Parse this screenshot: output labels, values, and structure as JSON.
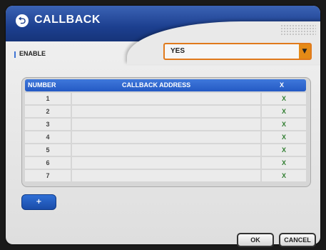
{
  "window": {
    "title": "CALLBACK",
    "title_icon": "circle-arrow-icon"
  },
  "enable": {
    "label": "ENABLE",
    "value": "YES",
    "arrow_icon": "dropdown-arrow-icon"
  },
  "table": {
    "headers": [
      "NUMBER",
      "CALLBACK ADDRESS",
      "X"
    ],
    "rows": [
      {
        "number": "1",
        "address": "",
        "delete": "X"
      },
      {
        "number": "2",
        "address": "",
        "delete": "X"
      },
      {
        "number": "3",
        "address": "",
        "delete": "X"
      },
      {
        "number": "4",
        "address": "",
        "delete": "X"
      },
      {
        "number": "5",
        "address": "",
        "delete": "X"
      },
      {
        "number": "6",
        "address": "",
        "delete": "X"
      },
      {
        "number": "7",
        "address": "",
        "delete": "X"
      }
    ]
  },
  "add_button": {
    "label": "+"
  },
  "buttons": {
    "ok": "OK",
    "cancel": "CANCEL"
  },
  "colors": {
    "title_bar": "#1c3f8f",
    "accent": "#245ac4",
    "dropdown_border": "#e07a1c",
    "delete_x": "#2f7d2f"
  }
}
